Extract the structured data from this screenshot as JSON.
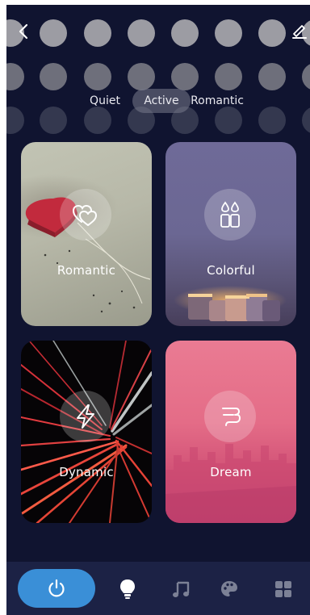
{
  "header": {
    "back_icon": "chevron-left-icon",
    "edit_icon": "pencil-icon"
  },
  "mode_tabs": [
    {
      "label": "Quiet",
      "selected": false
    },
    {
      "label": "Active",
      "selected": true
    },
    {
      "label": "Romantic",
      "selected": false
    }
  ],
  "scenes": [
    {
      "label": "Romantic",
      "icon": "hearts-icon"
    },
    {
      "label": "Colorful",
      "icon": "drops-icon"
    },
    {
      "label": "Dynamic",
      "icon": "lightning-icon"
    },
    {
      "label": "Dream",
      "icon": "cloud-icon"
    }
  ],
  "bottom_bar": {
    "power_icon": "power-icon",
    "power_color": "#3a8fd7",
    "tabs": [
      {
        "icon": "bulb-icon",
        "active": true
      },
      {
        "icon": "music-icon",
        "active": false
      },
      {
        "icon": "palette-icon",
        "active": false
      },
      {
        "icon": "grid-icon",
        "active": false
      }
    ]
  },
  "colors": {
    "background": "#101430",
    "bottom_bar": "#1c2245",
    "accent": "#3a8fd7"
  }
}
